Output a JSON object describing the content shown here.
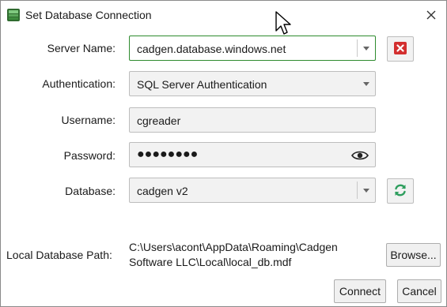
{
  "window": {
    "title": "Set Database Connection"
  },
  "form": {
    "server_name": {
      "label": "Server Name:",
      "value": "cadgen.database.windows.net"
    },
    "authentication": {
      "label": "Authentication:",
      "value": "SQL Server Authentication"
    },
    "username": {
      "label": "Username:",
      "value": "cgreader"
    },
    "password": {
      "label": "Password:",
      "value": "●●●●●●●●"
    },
    "database": {
      "label": "Database:",
      "value": "cadgen v2"
    },
    "local_path": {
      "label": "Local Database Path:",
      "line1": "C:\\Users\\acont\\AppData\\Roaming\\Cadgen",
      "line2": "Software LLC\\Local\\local_db.mdf"
    }
  },
  "buttons": {
    "browse": "Browse...",
    "connect": "Connect",
    "cancel": "Cancel"
  },
  "icons": {
    "app": "database-app-icon",
    "close": "close-icon",
    "clear_server": "red-x-clear-icon",
    "reveal": "eye-icon",
    "refresh": "refresh-icon",
    "cursor": "mouse-pointer-icon"
  },
  "colors": {
    "accent": "#2e8b2e",
    "clear": "#d32f2f",
    "refresh": "#2e9e5e"
  }
}
